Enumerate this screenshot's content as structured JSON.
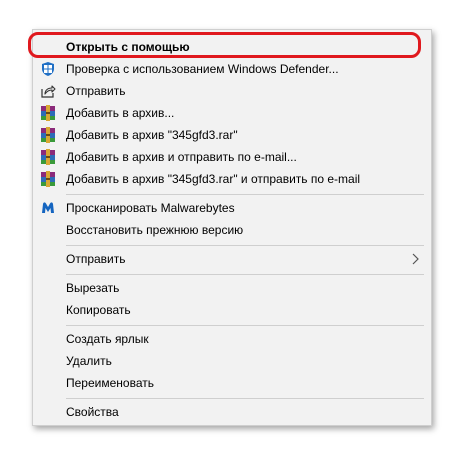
{
  "menu": {
    "items": [
      {
        "label": "Открыть с помощью",
        "icon": "none"
      },
      {
        "label": "Проверка с использованием Windows Defender...",
        "icon": "windows-defender-icon"
      },
      {
        "label": "Отправить",
        "icon": "share-icon"
      },
      {
        "label": "Добавить в архив...",
        "icon": "winrar-icon"
      },
      {
        "label": "Добавить в архив \"345gfd3.rar\"",
        "icon": "winrar-icon"
      },
      {
        "label": "Добавить в архив и отправить по e-mail...",
        "icon": "winrar-icon"
      },
      {
        "label": "Добавить в архив \"345gfd3.rar\" и отправить по e-mail",
        "icon": "winrar-icon"
      },
      {
        "label": "Просканировать Malwarebytes",
        "icon": "malwarebytes-icon"
      },
      {
        "label": "Восстановить прежнюю версию",
        "icon": "none"
      },
      {
        "label": "Отправить",
        "icon": "chevron-right-icon"
      },
      {
        "label": "Вырезать",
        "icon": "none"
      },
      {
        "label": "Копировать",
        "icon": "none"
      },
      {
        "label": "Создать ярлык",
        "icon": "none"
      },
      {
        "label": "Удалить",
        "icon": "none"
      },
      {
        "label": "Переименовать",
        "icon": "none"
      },
      {
        "label": "Свойства",
        "icon": "none"
      }
    ]
  },
  "colors": {
    "menu_background": "#f2f2f2",
    "highlight": "#e0191e",
    "separator": "#cfcfcf"
  }
}
